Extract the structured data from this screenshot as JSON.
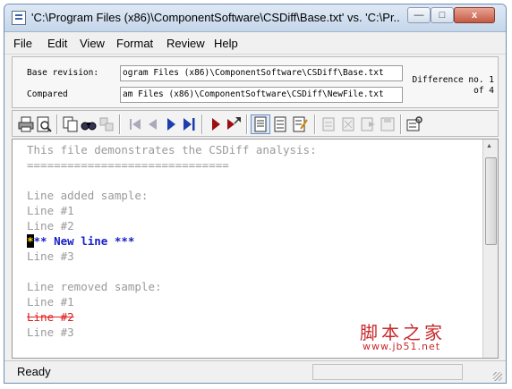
{
  "window": {
    "title": "'C:\\Program Files (x86)\\ComponentSoftware\\CSDiff\\Base.txt' vs. 'C:\\Pr...",
    "controls": {
      "minimize": "—",
      "maximize": "□",
      "close": "x"
    }
  },
  "menu": [
    "File",
    "Edit",
    "View",
    "Format",
    "Review",
    "Help"
  ],
  "revisions": {
    "base_label": "Base revision:",
    "base_value": "ogram Files (x86)\\ComponentSoftware\\CSDiff\\Base.txt",
    "compared_label": "Compared",
    "compared_value": "am Files (x86)\\ComponentSoftware\\CSDiff\\NewFile.txt",
    "difference_line1": "Difference no. 1",
    "difference_line2": "of 4"
  },
  "toolbar_icons": [
    "print-icon",
    "print-preview-icon",
    "copy-icon",
    "find-icon",
    "replace-icon",
    "first-difference-icon",
    "previous-difference-icon",
    "next-difference-icon",
    "last-difference-icon",
    "next-change-icon",
    "jump-to-change-icon",
    "view-merged-icon",
    "view-side-by-side-icon",
    "view-edit-icon",
    "accept-icon",
    "reject-icon",
    "export-icon",
    "save-report-icon",
    "properties-icon"
  ],
  "content_lines": [
    {
      "text": "This file demonstrates the CSDiff analysis:",
      "kind": "normal"
    },
    {
      "text": "==============================",
      "kind": "normal"
    },
    {
      "text": "",
      "kind": "normal"
    },
    {
      "text": "Line added sample:",
      "kind": "normal"
    },
    {
      "text": "Line #1",
      "kind": "normal"
    },
    {
      "text": "Line #2",
      "kind": "normal"
    },
    {
      "text": "*** New line ***",
      "kind": "added"
    },
    {
      "text": "Line #3",
      "kind": "normal"
    },
    {
      "text": "",
      "kind": "normal"
    },
    {
      "text": "Line removed sample:",
      "kind": "normal"
    },
    {
      "text": "Line #1",
      "kind": "normal"
    },
    {
      "text": "Line #2",
      "kind": "removed"
    },
    {
      "text": "Line #3",
      "kind": "normal"
    }
  ],
  "status": {
    "text": "Ready"
  },
  "watermark": {
    "text": "脚本之家",
    "url": "www.jb51.net"
  },
  "colors": {
    "added": "#1a20c7",
    "removed": "#e02020",
    "normal": "#9a9a9a",
    "watermark": "#c8282a"
  }
}
